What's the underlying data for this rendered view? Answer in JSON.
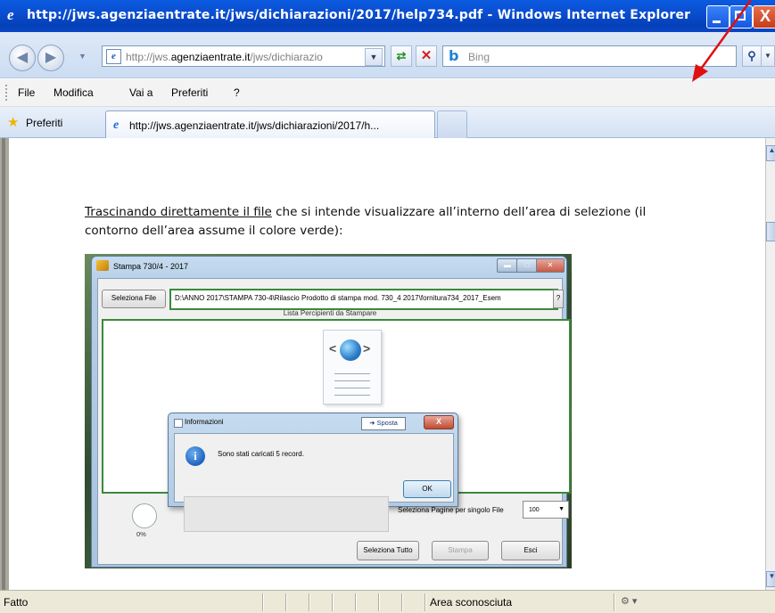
{
  "window": {
    "title": "http://jws.agenziaentrate.it/jws/dichiarazioni/2017/help734.pdf - Windows Internet Explorer",
    "close_glyph": "X"
  },
  "address_bar": {
    "url_prefix": "http://jws.",
    "url_domain": "agenziaentrate.it",
    "url_suffix": "/jws/dichiarazio",
    "search_placeholder": "Bing",
    "icons": [
      "back-icon",
      "forward-icon",
      "ie-page-icon",
      "refresh-icon",
      "stop-icon",
      "bing-icon",
      "search-icon"
    ]
  },
  "menu": {
    "items": [
      "File",
      "Modifica",
      "Vai a",
      "Preferiti",
      "?"
    ]
  },
  "favorites": {
    "label": "Preferiti",
    "tab_title": "http://jws.agenziaentrate.it/jws/dichiarazioni/2017/h..."
  },
  "content": {
    "paragraph_link": "Trascinando direttamente il file",
    "paragraph_rest": " che si intende visualizzare all’interno dell’area di selezione (il contorno dell’area assume il colore verde):"
  },
  "embedded": {
    "window_title": "Stampa 730/4 - 2017",
    "select_file_button": "Seleziona File",
    "file_path": "D:\\ANNO 2017\\STAMPA 730-4\\Rilascio Prodotto di stampa mod. 730_4 2017\\fornitura734_2017_Esem",
    "help_button": "?",
    "list_title": "Lista Percipienti da Stampare",
    "dialog": {
      "title": "Informazioni",
      "sposta": "Sposta",
      "message": "Sono stati caricati 5 record.",
      "ok": "OK",
      "close": "X"
    },
    "progress": "0%",
    "pages_label": "Seleziona Pagine per singolo File",
    "pages_value": "100",
    "buttons": {
      "select_all": "Seleziona Tutto",
      "print": "Stampa",
      "exit": "Esci"
    }
  },
  "status": {
    "text": "Fatto",
    "zone": "Area sconosciuta"
  },
  "colors": {
    "titlebar": "#0b4ed0",
    "selection_border": "#3a8a3a",
    "annotation_arrow": "#e01010"
  }
}
